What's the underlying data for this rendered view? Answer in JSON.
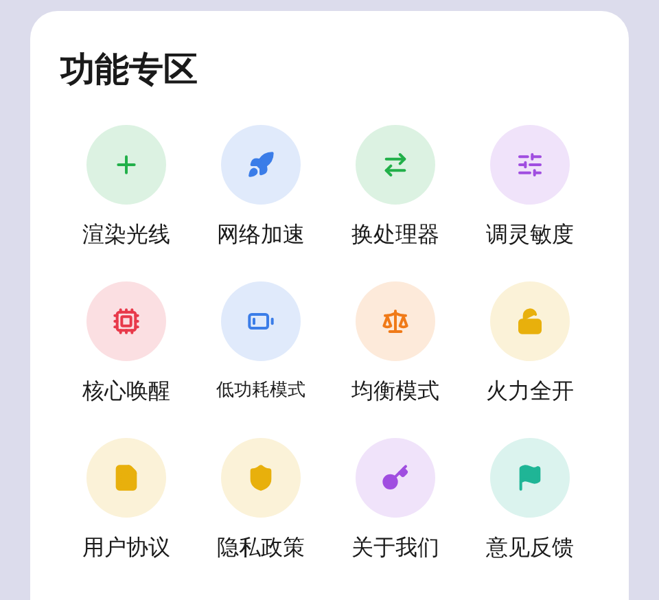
{
  "title": "功能专区",
  "items": [
    {
      "label": "渲染光线",
      "kind": "plus",
      "color": "#22b04a"
    },
    {
      "label": "网络加速",
      "kind": "rocket",
      "color": "#3b7de8"
    },
    {
      "label": "换处理器",
      "kind": "swap",
      "color": "#22b04a"
    },
    {
      "label": "调灵敏度",
      "kind": "sliders",
      "color": "#a04ee0"
    },
    {
      "label": "核心唤醒",
      "kind": "chip",
      "color": "#e8394a"
    },
    {
      "label": "低功耗模式",
      "kind": "battery",
      "color": "#3b7de8"
    },
    {
      "label": "均衡模式",
      "kind": "scale",
      "color": "#f07a18"
    },
    {
      "label": "火力全开",
      "kind": "unlock",
      "color": "#e8b00c"
    },
    {
      "label": "用户协议",
      "kind": "document",
      "color": "#e8b00c"
    },
    {
      "label": "隐私政策",
      "kind": "shield",
      "color": "#e8b00c"
    },
    {
      "label": "关于我们",
      "kind": "key",
      "color": "#a04ee0"
    },
    {
      "label": "意见反馈",
      "kind": "flag",
      "color": "#1fb596"
    }
  ]
}
